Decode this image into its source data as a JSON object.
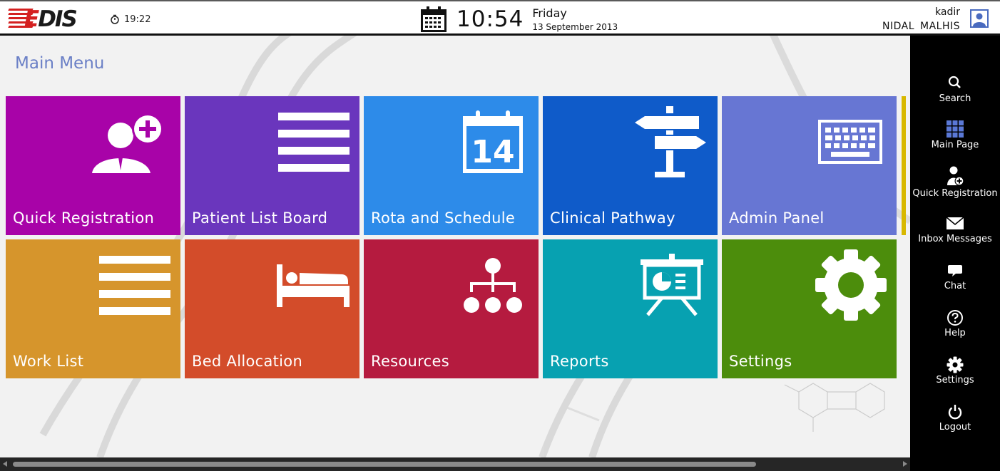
{
  "header": {
    "logo_text": "EDIS",
    "session_time": "19:22",
    "clock": {
      "time": "10:54",
      "day": "Friday",
      "date": "13 September 2013"
    },
    "user": {
      "username": "kadir",
      "full_name": "NIDAL  MALHIS"
    }
  },
  "main": {
    "title": "Main Menu",
    "tiles": [
      {
        "label": "Quick Registration",
        "color": "#a803a8",
        "icon": "add-user-icon"
      },
      {
        "label": "Patient List Board",
        "color": "#6a36bd",
        "icon": "list-icon"
      },
      {
        "label": "Rota and Schedule",
        "color": "#2d8be9",
        "icon": "calendar-icon",
        "icon_text": "14"
      },
      {
        "label": "Clinical Pathway",
        "color": "#0f5bc9",
        "icon": "signpost-icon"
      },
      {
        "label": "Admin Panel",
        "color": "#6776d3",
        "icon": "keyboard-icon"
      },
      {
        "label": "Work List",
        "color": "#d6952c",
        "icon": "list-icon"
      },
      {
        "label": "Bed Allocation",
        "color": "#d34c2a",
        "icon": "bed-icon"
      },
      {
        "label": "Resources",
        "color": "#b51b3f",
        "icon": "hierarchy-icon"
      },
      {
        "label": "Reports",
        "color": "#07a1b1",
        "icon": "presentation-icon"
      },
      {
        "label": "Settings",
        "color": "#4c8d0c",
        "icon": "gear-icon"
      }
    ]
  },
  "sidebar": {
    "items": [
      {
        "label": "Search",
        "icon": "search-icon"
      },
      {
        "label": "Main Page",
        "icon": "grid-icon"
      },
      {
        "label": "Quick Registration",
        "icon": "add-user-icon"
      },
      {
        "label": "Inbox Messages",
        "icon": "envelope-icon"
      },
      {
        "label": "Chat",
        "icon": "chat-icon"
      },
      {
        "label": "Help",
        "icon": "help-icon"
      },
      {
        "label": "Settings",
        "icon": "gear-icon"
      },
      {
        "label": "Logout",
        "icon": "power-icon"
      }
    ]
  },
  "colors": {
    "accent": "#6a7fc6",
    "sidebar_bg": "#000000",
    "scroll_hint": "#d8b800"
  }
}
